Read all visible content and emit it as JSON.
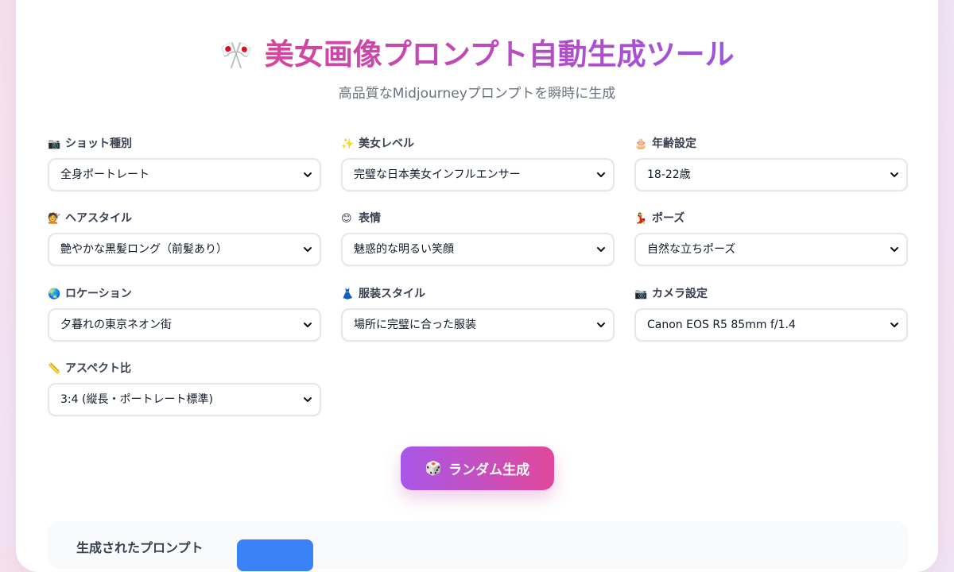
{
  "header": {
    "icon": "crossed-flags-icon",
    "title": "美女画像プロンプト自動生成ツール",
    "subtitle": "高品質なMidjourneyプロンプトを瞬時に生成"
  },
  "fields": [
    {
      "icon": "camera-icon",
      "icon_glyph": "📷",
      "label": "ショット種別",
      "value": "全身ポートレート"
    },
    {
      "icon": "sparkles-icon",
      "icon_glyph": "✨",
      "label": "美女レベル",
      "value": "完璧な日本美女インフルエンサー"
    },
    {
      "icon": "cake-icon",
      "icon_glyph": "🎂",
      "label": "年齢設定",
      "value": "18-22歳"
    },
    {
      "icon": "haircut-icon",
      "icon_glyph": "💇",
      "label": "ヘアスタイル",
      "value": "艶やかな黒髪ロング（前髪あり）"
    },
    {
      "icon": "smile-icon",
      "icon_glyph": "😊",
      "label": "表情",
      "value": "魅惑的な明るい笑顔"
    },
    {
      "icon": "dancer-icon",
      "icon_glyph": "💃",
      "label": "ポーズ",
      "value": "自然な立ちポーズ"
    },
    {
      "icon": "globe-icon",
      "icon_glyph": "🌏",
      "label": "ロケーション",
      "value": "夕暮れの東京ネオン街"
    },
    {
      "icon": "dress-icon",
      "icon_glyph": "👗",
      "label": "服装スタイル",
      "value": "場所に完璧に合った服装"
    },
    {
      "icon": "camera-icon",
      "icon_glyph": "📷",
      "label": "カメラ設定",
      "value": "Canon EOS R5 85mm f/1.4"
    },
    {
      "icon": "ruler-icon",
      "icon_glyph": "📏",
      "label": "アスペクト比",
      "value": "3:4 (縦長・ポートレート標準)"
    }
  ],
  "generate_button": {
    "icon": "dice-icon",
    "icon_glyph": "🎲",
    "label": "ランダム生成"
  },
  "output": {
    "title_partial": "生成されたプロンプト"
  },
  "colors": {
    "title_gradient_start": "#d7449c",
    "title_gradient_end": "#9a55e0",
    "button_gradient_start": "#a857e8",
    "button_gradient_end": "#e0489a",
    "copy_button": "#3b82f6"
  }
}
